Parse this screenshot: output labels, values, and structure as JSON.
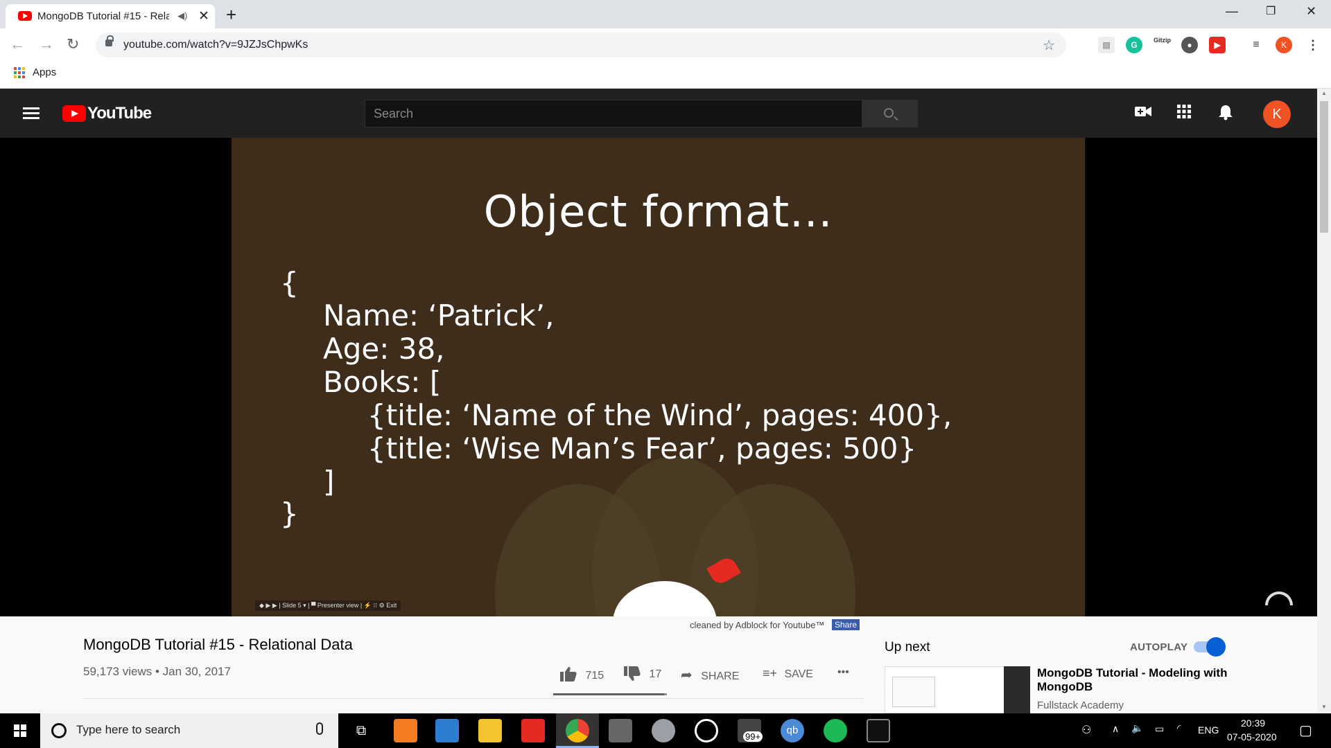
{
  "browser": {
    "tab_title": "MongoDB Tutorial #15 - Rela",
    "tab_audio_icon": "speaker-icon",
    "new_tab": "+",
    "url": "youtube.com/watch?v=9JZJsChpwKs",
    "bookmarks_apps": "Apps",
    "profile_initial": "K",
    "extension_zip": "Gitzip"
  },
  "youtube": {
    "wordmark": "YouTube",
    "search_placeholder": "Search",
    "avatar_initial": "K"
  },
  "video": {
    "slide_title": "Object format...",
    "code_lines": [
      "{",
      "Name: ‘Patrick’,",
      "Age: 38,",
      "Books: [",
      "{title: ‘Name of the Wind’, pages: 400},",
      "{title: ‘Wise Man’s Fear’, pages: 500}",
      "]",
      "}"
    ],
    "presenter_bar": "◆ ▶ ▶ | Slide 5 ▾ | ▀ Presenter view | ⚡ ⁝⁝ ⚙ Exit"
  },
  "below_video": {
    "adblock_note": "cleaned by Adblock for Youtube™",
    "adblock_share": "Share",
    "title": "MongoDB Tutorial #15 - Relational Data",
    "meta": "59,173 views • Jan 30, 2017",
    "likes": "715",
    "dislikes": "17",
    "like_ratio": 0.977,
    "share_label": "SHARE",
    "save_label": "SAVE",
    "more": "•••"
  },
  "sidebar": {
    "up_next": "Up next",
    "autoplay": "AUTOPLAY",
    "autoplay_on": true,
    "next_title": "MongoDB Tutorial - Modeling with MongoDB",
    "next_channel": "Fullstack Academy"
  },
  "taskbar": {
    "search_placeholder": "Type here to search",
    "badge": "99+",
    "lang": "ENG",
    "time": "20:39",
    "date": "07-05-2020",
    "qb": "qb"
  },
  "colors": {
    "yt_red": "#ff0000",
    "masthead": "#212121",
    "slide_bg": "#3f2d1c",
    "accent_blue": "#065fd4"
  }
}
